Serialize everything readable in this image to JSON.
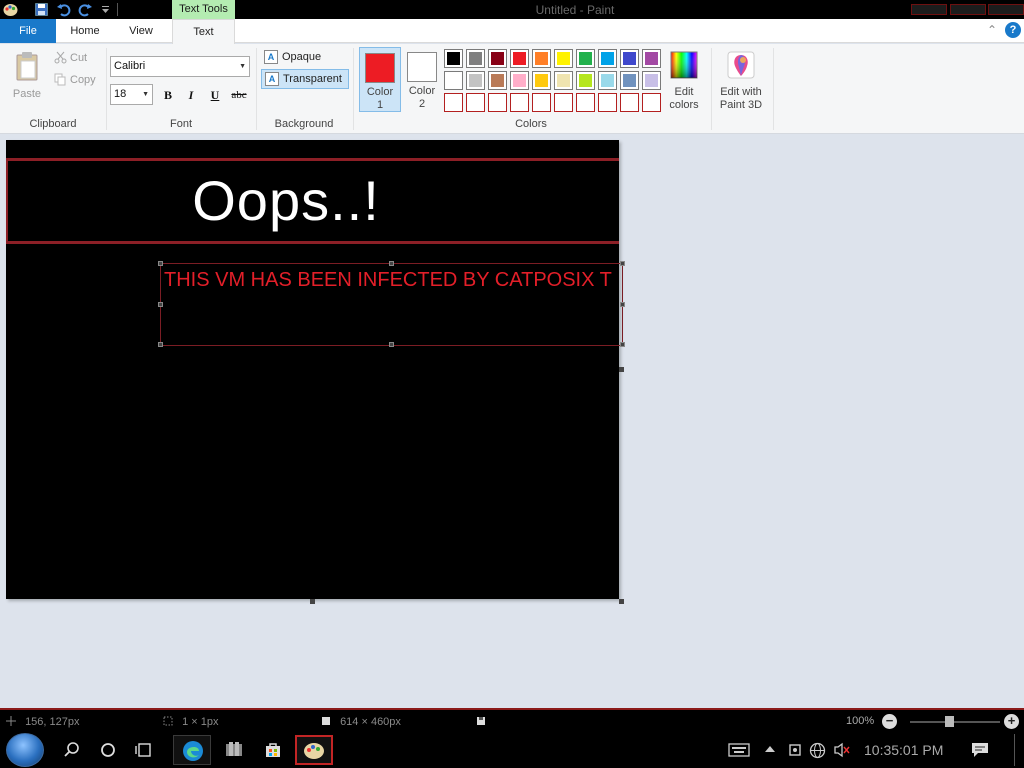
{
  "window": {
    "title": "Untitled - Paint"
  },
  "context_tab": "Text Tools",
  "tabs": [
    "File",
    "Home",
    "View",
    "Text"
  ],
  "ribbon": {
    "clipboard": {
      "paste": "Paste",
      "cut": "Cut",
      "copy": "Copy",
      "group_label": "Clipboard"
    },
    "font": {
      "family": "Calibri",
      "size": "18",
      "bold": "B",
      "italic": "I",
      "underline": "U",
      "strike": "abc",
      "group_label": "Font"
    },
    "background": {
      "opaque": "Opaque",
      "transparent": "Transparent",
      "selected": "Transparent",
      "group_label": "Background"
    },
    "colors": {
      "color1_label": "Color\n1",
      "color2_label": "Color\n2",
      "color1": "#ed1c24",
      "color2": "#ffffff",
      "edit_colors": "Edit\ncolors",
      "group_label": "Colors",
      "palette_row1": [
        "#000000",
        "#7f7f7f",
        "#880015",
        "#ed1c24",
        "#ff7f27",
        "#fff200",
        "#22b14c",
        "#00a2e8",
        "#3f48cc",
        "#a349a4"
      ],
      "palette_row2": [
        "#ffffff",
        "#c3c3c3",
        "#b97a57",
        "#ffaec9",
        "#ffc90e",
        "#efe4b0",
        "#b5e61d",
        "#99d9ea",
        "#7092be",
        "#c8bfe7"
      ]
    },
    "paint3d": {
      "label": "Edit with\nPaint 3D"
    }
  },
  "canvas": {
    "title_text": "Oops..!",
    "textbox_text": "THIS VM HAS BEEN INFECTED BY CATPOSIX T",
    "background": "#000000",
    "banner_border": "#8c1f26",
    "text_color": "#e31f29"
  },
  "status": {
    "cursor_pos": "156, 127px",
    "selection_size": "1 × 1px",
    "image_size": "614 × 460px",
    "zoom": "100%"
  },
  "taskbar": {
    "clock": "10:35:01 PM"
  }
}
